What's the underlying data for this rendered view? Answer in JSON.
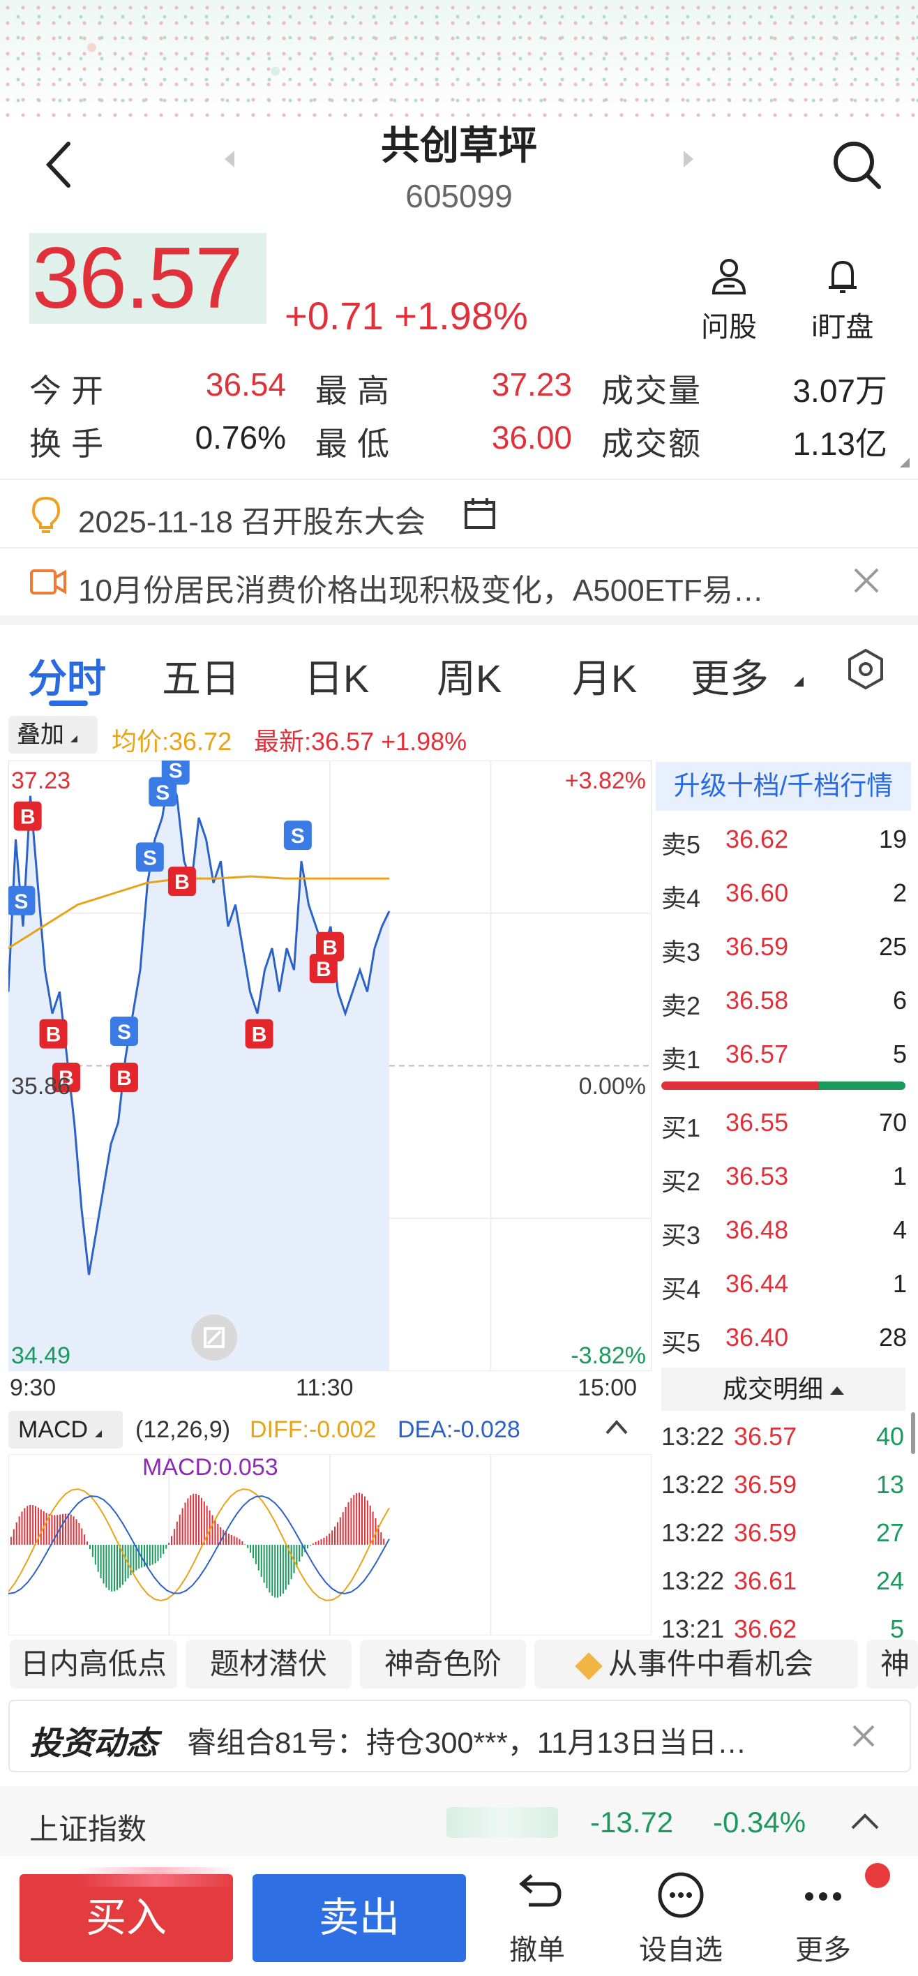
{
  "colors": {
    "up": "#e0313a",
    "down": "#1a9a5c",
    "accent": "#2a6ae0",
    "avg_line": "#e8a317",
    "price_line": "#2a62c9"
  },
  "header": {
    "title": "共创草坪",
    "code": "605099"
  },
  "quote": {
    "price": "36.57",
    "change": "+0.71",
    "change_pct": "+1.98%",
    "ask_label": "问股",
    "watch_label": "i盯盘",
    "stats": [
      {
        "label": "今开",
        "value": "36.54"
      },
      {
        "label": "最高",
        "value": "37.23"
      },
      {
        "label": "成交量",
        "value": "3.07万"
      },
      {
        "label": "换手",
        "value": "0.76%"
      },
      {
        "label": "最低",
        "value": "36.00"
      },
      {
        "label": "成交额",
        "value": "1.13亿"
      }
    ]
  },
  "notices": {
    "event": "2025-11-18 召开股东大会",
    "news": "10月份居民消费价格出现积极变化，A500ETF易…"
  },
  "tabs": [
    "分时",
    "五日",
    "日K",
    "周K",
    "月K",
    "更多"
  ],
  "chart_toolbar": {
    "overlay": "叠加",
    "avg": "均价:36.72",
    "latest": "最新:36.57 +1.98%"
  },
  "chart": {
    "y_high": "37.23",
    "y_mid": "35.86",
    "y_low": "34.49",
    "pct_high": "+3.82%",
    "pct_mid": "0.00%",
    "pct_low": "-3.82%",
    "x_start": "9:30",
    "x_mid": "11:30",
    "x_end": "15:00"
  },
  "chart_data": {
    "type": "line",
    "title": "",
    "y_range": [
      34.49,
      37.23
    ],
    "x_labels": [
      "9:30",
      "11:30",
      "15:00"
    ],
    "series": [
      {
        "values": [
          36.2,
          36.9,
          36.5,
          37.1,
          36.7,
          36.3,
          36.1,
          36.2,
          35.9,
          35.6,
          35.2,
          34.9,
          35.1,
          35.3,
          35.5,
          35.6,
          35.9,
          36.1,
          36.3,
          36.7,
          36.9,
          37.0,
          37.2,
          37.1,
          36.8,
          36.7,
          37.0,
          36.9,
          36.7,
          36.8,
          36.5,
          36.6,
          36.4,
          36.2,
          36.1,
          36.3,
          36.4,
          36.2,
          36.4,
          36.3,
          36.8,
          36.6,
          36.5,
          36.4,
          36.5,
          36.2,
          36.1,
          36.2,
          36.3,
          36.2,
          36.4,
          36.5,
          36.57
        ]
      },
      {
        "values": [
          36.4,
          36.5,
          36.6,
          36.65,
          36.7,
          36.72,
          36.72,
          36.73,
          36.72,
          36.72,
          36.72,
          36.72
        ]
      }
    ],
    "sell_markers_x": [
      0.02,
      0.22,
      0.24,
      0.18,
      0.26,
      0.45
    ],
    "buy_markers_x": [
      0.03,
      0.07,
      0.09,
      0.18,
      0.27,
      0.39,
      0.49,
      0.5
    ]
  },
  "order_book": {
    "header": "升级十档/千档行情",
    "asks": [
      {
        "label": "卖5",
        "price": "36.62",
        "vol": "19"
      },
      {
        "label": "卖4",
        "price": "36.60",
        "vol": "2"
      },
      {
        "label": "卖3",
        "price": "36.59",
        "vol": "25"
      },
      {
        "label": "卖2",
        "price": "36.58",
        "vol": "6"
      },
      {
        "label": "卖1",
        "price": "36.57",
        "vol": "5"
      }
    ],
    "bids": [
      {
        "label": "买1",
        "price": "36.55",
        "vol": "70"
      },
      {
        "label": "买2",
        "price": "36.53",
        "vol": "1"
      },
      {
        "label": "买3",
        "price": "36.48",
        "vol": "4"
      },
      {
        "label": "买4",
        "price": "36.44",
        "vol": "1"
      },
      {
        "label": "买5",
        "price": "36.40",
        "vol": "28"
      }
    ],
    "trades_header": "成交明细",
    "trades": [
      {
        "time": "13:22",
        "price": "36.57",
        "vol": "40"
      },
      {
        "time": "13:22",
        "price": "36.59",
        "vol": "13"
      },
      {
        "time": "13:22",
        "price": "36.59",
        "vol": "27"
      },
      {
        "time": "13:22",
        "price": "36.61",
        "vol": "24"
      },
      {
        "time": "13:21",
        "price": "36.62",
        "vol": "5"
      }
    ]
  },
  "macd": {
    "label": "MACD",
    "params": "(12,26,9)",
    "diff": "DIFF:-0.002",
    "dea": "DEA:-0.028",
    "macd": "MACD:0.053"
  },
  "chips": [
    "日内高低点",
    "题材潜伏",
    "神奇色阶",
    "从事件中看机会",
    "神"
  ],
  "news_ticker": {
    "brand": "投资动态",
    "text": "睿组合81号：持仓300***，11月13日当日…"
  },
  "index_bar": {
    "name": "上证指数",
    "change": "-13.72",
    "pct": "-0.34%"
  },
  "bottom": {
    "buy": "买入",
    "sell": "卖出",
    "cancel": "撤单",
    "watch": "设自选",
    "more": "更多"
  }
}
